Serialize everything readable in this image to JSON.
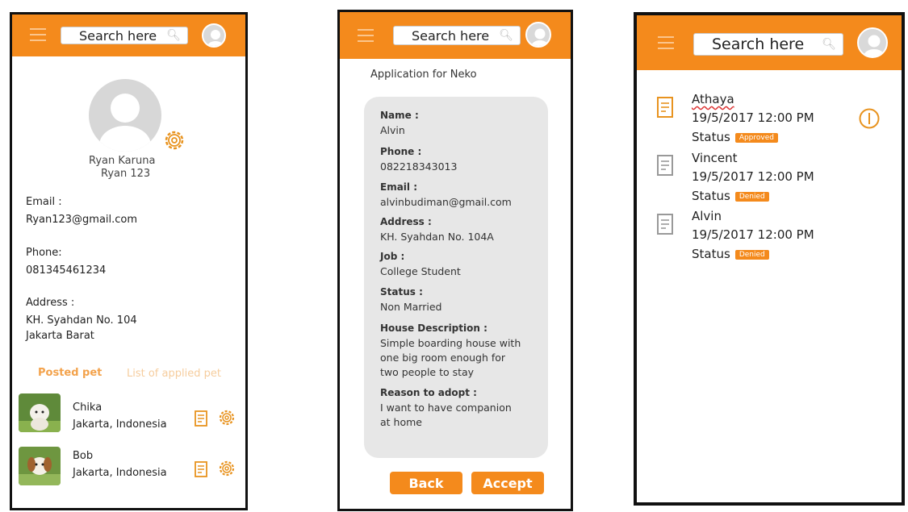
{
  "search": {
    "placeholder": "Search here"
  },
  "profile": {
    "name": "Ryan Karuna",
    "username": "Ryan 123",
    "email_label": "Email :",
    "email": "Ryan123@gmail.com",
    "phone_label": "Phone:",
    "phone": "081345461234",
    "address_label": "Address :",
    "address_line1": "KH. Syahdan No. 104",
    "address_line2": "Jakarta Barat",
    "tabs": {
      "posted": "Posted pet",
      "applied": "List of applied pet"
    },
    "pets": [
      {
        "name": "Chika",
        "location": "Jakarta, Indonesia"
      },
      {
        "name": "Bob",
        "location": "Jakarta, Indonesia"
      }
    ]
  },
  "application": {
    "title": "Application for Neko",
    "fields": {
      "name_label": "Name :",
      "name": "Alvin",
      "phone_label": "Phone :",
      "phone": "082218343013",
      "email_label": "Email :",
      "email": "alvinbudiman@gmail.com",
      "address_label": "Address :",
      "address": "KH. Syahdan No. 104A",
      "job_label": "Job :",
      "job": "College Student",
      "status_label": "Status :",
      "status": "Non Married",
      "house_label": "House Description :",
      "house_line1": "Simple boarding house with",
      "house_line2": "one big room enough for",
      "house_line3": "two people to stay",
      "reason_label": "Reason to adopt :",
      "reason_line1": "I want to have companion",
      "reason_line2": "at home"
    },
    "buttons": {
      "back": "Back",
      "accept": "Accept"
    }
  },
  "applicants": {
    "status_label": "Status",
    "items": [
      {
        "name": "Athaya",
        "date": "19/5/2017 12:00 PM",
        "badge": "Approved"
      },
      {
        "name": "Vincent",
        "date": "19/5/2017 12:00 PM",
        "badge": "Denied"
      },
      {
        "name": "Alvin",
        "date": "19/5/2017 12:00 PM",
        "badge": "Denied"
      }
    ]
  },
  "colors": {
    "accent": "#f48a1c",
    "accent_light": "#f6cd9e",
    "card_bg": "#e7e7e7"
  },
  "icons": [
    "menu-icon",
    "search-icon",
    "user-avatar-icon",
    "gear-icon",
    "document-icon",
    "info-icon"
  ]
}
